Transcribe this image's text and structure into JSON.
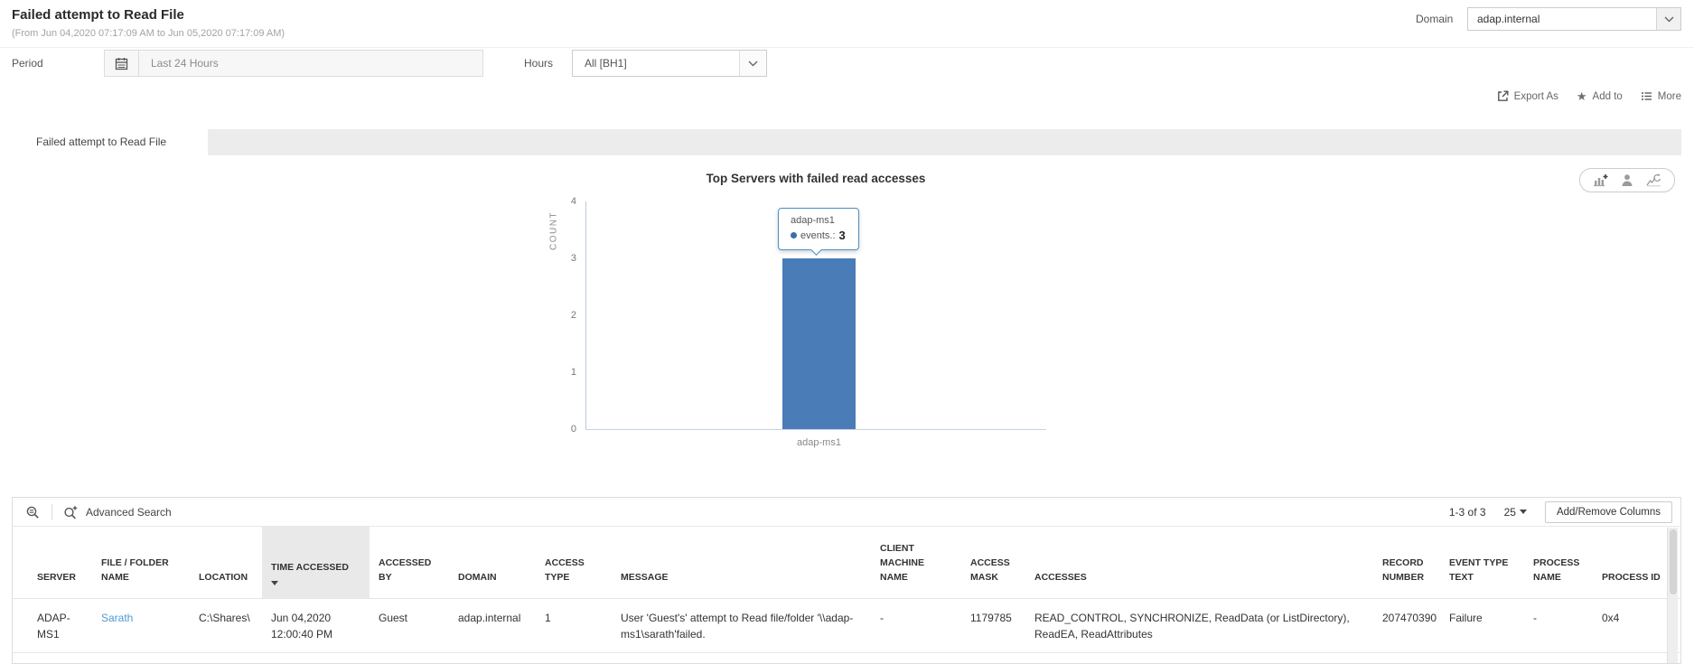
{
  "header": {
    "title": "Failed attempt to Read File",
    "subtitle": "(From Jun 04,2020 07:17:09 AM to Jun 05,2020 07:17:09 AM)",
    "domain_label": "Domain",
    "domain_value": "adap.internal"
  },
  "filters": {
    "period_label": "Period",
    "period_value": "Last 24 Hours",
    "hours_label": "Hours",
    "hours_value": "All [BH1]"
  },
  "actions": {
    "export_as": "Export As",
    "add_to": "Add to",
    "more": "More"
  },
  "tab": {
    "label": "Failed attempt to Read File"
  },
  "chart_data": {
    "type": "bar",
    "title": "Top Servers with failed read accesses",
    "categories": [
      "adap-ms1"
    ],
    "series": [
      {
        "name": "events.",
        "values": [
          3
        ]
      }
    ],
    "values": [
      3
    ],
    "xlabel": "",
    "ylabel": "COUNT",
    "ylim": [
      0,
      4
    ],
    "yticks": [
      "4",
      "3",
      "2",
      "1",
      "0"
    ],
    "grid": false,
    "legend": "none",
    "bar_color": "#4a7db8",
    "tooltip": {
      "title": "adap-ms1",
      "series_label": "events.:",
      "value": "3"
    }
  },
  "table": {
    "advanced_search_label": "Advanced Search",
    "pagination": {
      "range": "1-3 of 3",
      "page_size": "25"
    },
    "add_remove_columns_label": "Add/Remove Columns",
    "columns": [
      "SERVER",
      "FILE / FOLDER NAME",
      "LOCATION",
      "TIME ACCESSED",
      "ACCESSED BY",
      "DOMAIN",
      "ACCESS TYPE",
      "MESSAGE",
      "CLIENT MACHINE NAME",
      "ACCESS MASK",
      "ACCESSES",
      "RECORD NUMBER",
      "EVENT TYPE TEXT",
      "PROCESS NAME",
      "PROCESS ID"
    ],
    "sorted_column": "TIME ACCESSED",
    "sort_direction": "desc",
    "rows": [
      [
        "ADAP-MS1",
        "Sarath",
        "C:\\Shares\\",
        "Jun 04,2020 12:00:40 PM",
        "Guest",
        "adap.internal",
        "1",
        "User 'Guest's' attempt to Read file/folder '\\\\adap-ms1\\sarath'failed.",
        "-",
        "1179785",
        "READ_CONTROL, SYNCHRONIZE, ReadData (or ListDirectory), ReadEA, ReadAttributes",
        "207470390",
        "Failure",
        "-",
        "0x4"
      ]
    ]
  }
}
